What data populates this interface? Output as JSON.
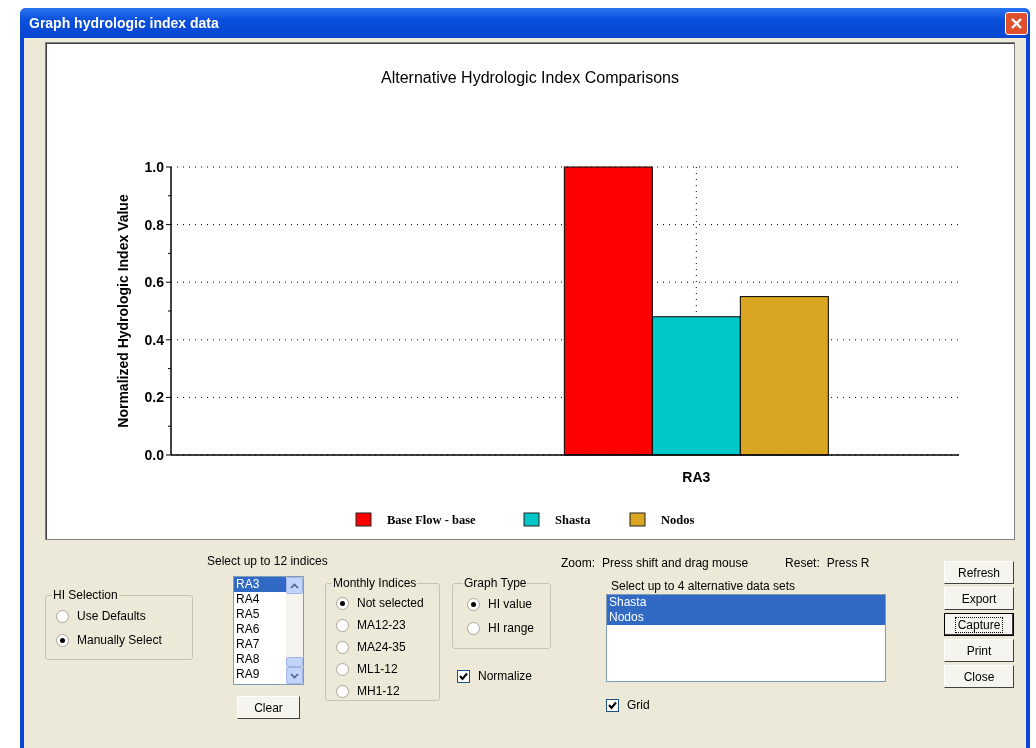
{
  "window": {
    "title": "Graph hydrologic index data"
  },
  "chart": {
    "chart_data": {
      "type": "bar",
      "title": "Alternative Hydrologic Index Comparisons",
      "ylabel": "Normalized Hydrologic Index Value",
      "categories": [
        "RA3"
      ],
      "series": [
        {
          "name": "Base Flow - base",
          "color": "#ff0000",
          "values": [
            1.0
          ]
        },
        {
          "name": "Shasta",
          "color": "#00c8c8",
          "values": [
            0.48
          ]
        },
        {
          "name": "Nodos",
          "color": "#daa520",
          "values": [
            0.55
          ]
        }
      ],
      "ylim": [
        0,
        1
      ],
      "grid": true,
      "legend": "bottom",
      "yticks": [
        {
          "value": 0,
          "label": "0.0"
        },
        {
          "value": 0.2,
          "label": "0.2"
        },
        {
          "value": 0.4,
          "label": "0.4"
        },
        {
          "value": 0.6,
          "label": "0.6"
        },
        {
          "value": 0.8,
          "label": "0.8"
        },
        {
          "value": 1,
          "label": "1.0"
        }
      ]
    }
  },
  "zoom_hint": {
    "label": "Zoom:",
    "text": "Press shift and drag mouse"
  },
  "reset_hint": {
    "label": "Reset:",
    "text": "Press R"
  },
  "hi_selection": {
    "title": "HI Selection",
    "options": [
      {
        "label": "Use Defaults",
        "selected": false
      },
      {
        "label": "Manually Select",
        "selected": true
      }
    ]
  },
  "indices": {
    "label": "Select up to 12 indices",
    "items": [
      {
        "label": "RA3",
        "selected": true
      },
      {
        "label": "RA4",
        "selected": false
      },
      {
        "label": "RA5",
        "selected": false
      },
      {
        "label": "RA6",
        "selected": false
      },
      {
        "label": "RA7",
        "selected": false
      },
      {
        "label": "RA8",
        "selected": false
      },
      {
        "label": "RA9",
        "selected": false
      }
    ],
    "clear_button": "Clear"
  },
  "monthly_indices": {
    "title": "Monthly Indices",
    "options": [
      {
        "label": "Not selected",
        "selected": true
      },
      {
        "label": "MA12-23",
        "selected": false
      },
      {
        "label": "MA24-35",
        "selected": false
      },
      {
        "label": "ML1-12",
        "selected": false
      },
      {
        "label": "MH1-12",
        "selected": false
      }
    ]
  },
  "graph_type": {
    "title": "Graph Type",
    "options": [
      {
        "label": "HI value",
        "selected": true
      },
      {
        "label": "HI range",
        "selected": false
      }
    ]
  },
  "normalize": {
    "label": "Normalize",
    "checked": true
  },
  "datasets": {
    "label": "Select up to 4 alternative data sets",
    "items": [
      {
        "label": "Shasta",
        "selected": true
      },
      {
        "label": "Nodos",
        "selected": true
      }
    ]
  },
  "grid": {
    "label": "Grid",
    "checked": true
  },
  "buttons": [
    {
      "label": "Refresh",
      "focused": false
    },
    {
      "label": "Export",
      "focused": false
    },
    {
      "label": "Capture",
      "focused": true
    },
    {
      "label": "Print",
      "focused": false
    },
    {
      "label": "Close",
      "focused": false
    }
  ]
}
